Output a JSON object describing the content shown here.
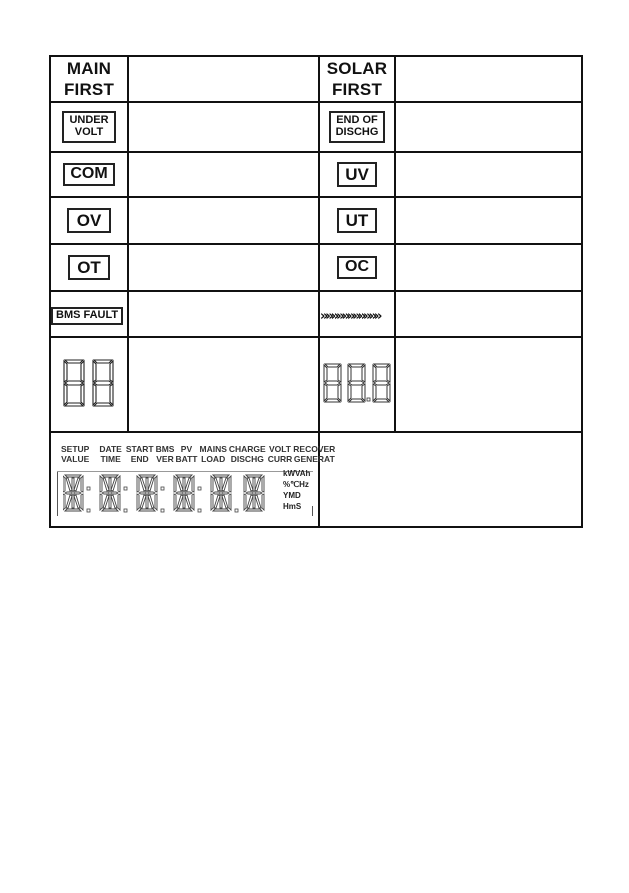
{
  "table": {
    "rows": [
      {
        "left_icon": {
          "type": "text",
          "lines": [
            "MAIN",
            "FIRST"
          ]
        },
        "left_desc": "",
        "right_icon": {
          "type": "text",
          "lines": [
            "SOLAR",
            "FIRST"
          ]
        },
        "right_desc": ""
      },
      {
        "left_icon": {
          "type": "boxed",
          "lines": [
            "UNDER",
            "VOLT"
          ]
        },
        "left_desc": "",
        "right_icon": {
          "type": "boxed",
          "lines": [
            "END OF",
            "DISCHG"
          ]
        },
        "right_desc": ""
      },
      {
        "left_icon": {
          "type": "boxed",
          "lines": [
            "COM"
          ]
        },
        "left_desc": "",
        "right_icon": {
          "type": "boxed",
          "lines": [
            "UV"
          ]
        },
        "right_desc": ""
      },
      {
        "left_icon": {
          "type": "boxed",
          "lines": [
            "OV"
          ]
        },
        "left_desc": "",
        "right_icon": {
          "type": "boxed",
          "lines": [
            "UT"
          ]
        },
        "right_desc": ""
      },
      {
        "left_icon": {
          "type": "boxed",
          "lines": [
            "OT"
          ]
        },
        "left_desc": "",
        "right_icon": {
          "type": "boxed",
          "lines": [
            "OC"
          ]
        },
        "right_desc": ""
      },
      {
        "left_icon": {
          "type": "boxed",
          "lines": [
            "BMS FAULT"
          ]
        },
        "left_desc": "",
        "right_icon": {
          "type": "chevron-bar",
          "glyphs": "»»»»»»»»»»»"
        },
        "right_desc": ""
      },
      {
        "left_icon": {
          "type": "seven-segment",
          "digits": "88"
        },
        "left_desc": "",
        "right_icon": {
          "type": "seven-segment",
          "digits": "88.8"
        },
        "right_desc": ""
      }
    ],
    "lcd_row": {
      "top_labels": [
        [
          "SETUP",
          "VALUE"
        ],
        [
          "DATE",
          "TIME"
        ],
        [
          "START",
          "END"
        ],
        [
          "BMS",
          "VER"
        ],
        [
          "PV",
          "BATT"
        ],
        [
          "MAINS",
          "LOAD"
        ],
        [
          "CHARGE",
          "DISCHG"
        ],
        [
          "VOLT",
          "CURR"
        ],
        [
          "RECOVER",
          "GENERAT"
        ]
      ],
      "unit_labels": [
        "kWVAh",
        "%℃Hz",
        "YMD",
        "HmS"
      ],
      "display_chars": 6,
      "desc": ""
    }
  }
}
